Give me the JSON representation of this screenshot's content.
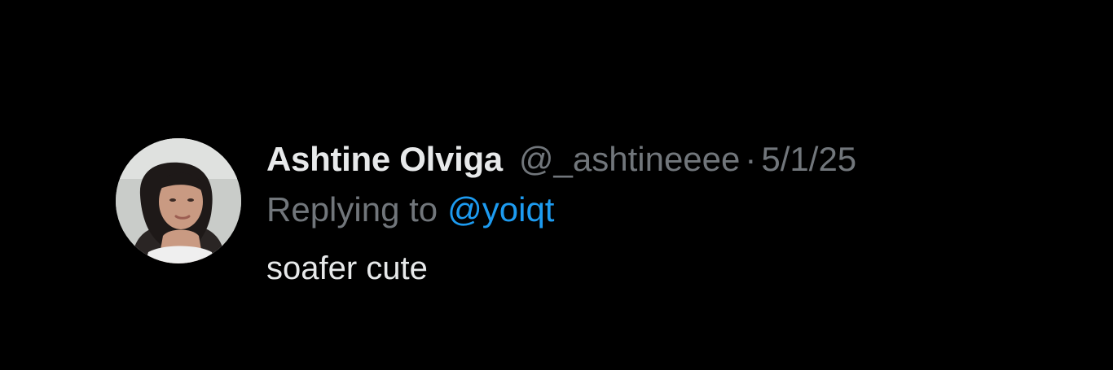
{
  "tweet": {
    "author": {
      "display_name": "Ashtine Olviga",
      "handle": "@_ashtineeee",
      "avatar_icon": "profile-photo"
    },
    "separator": "·",
    "date": "5/1/25",
    "reply": {
      "prefix": "Replying to",
      "mention": "@yoiqt"
    },
    "text": "soafer cute"
  },
  "colors": {
    "background": "#000000",
    "primary_text": "#e7e9ea",
    "secondary_text": "#71767b",
    "link": "#1d9bf0"
  }
}
